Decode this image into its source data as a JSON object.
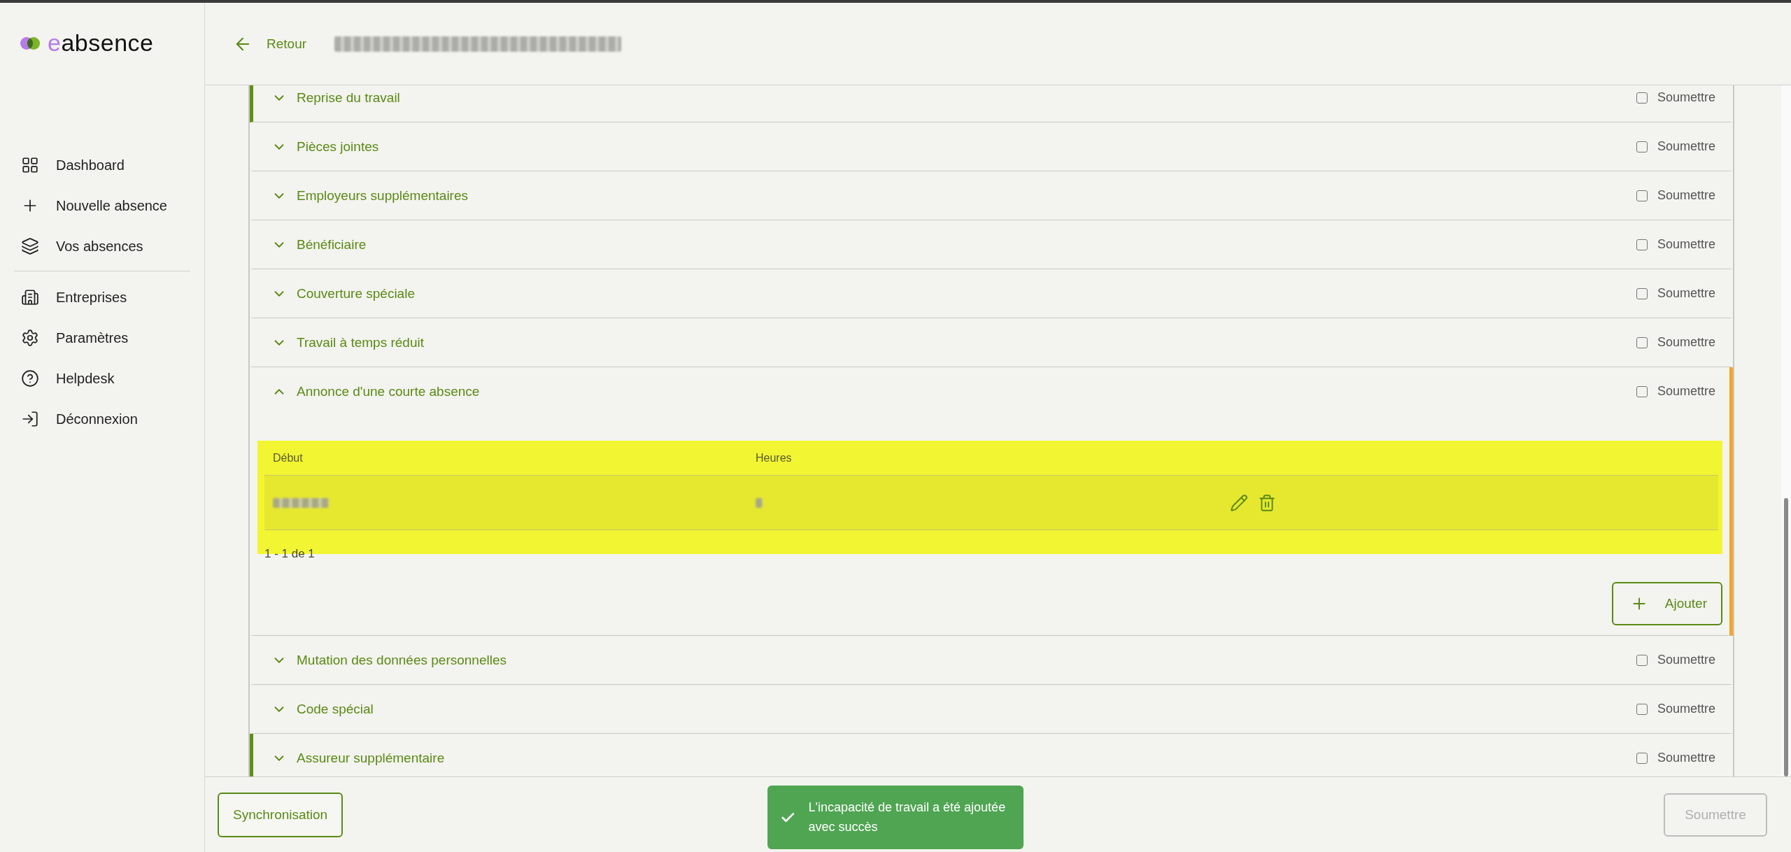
{
  "logo": {
    "accent": "e",
    "text": "absence"
  },
  "nav": [
    {
      "items": [
        {
          "label": "Dashboard"
        },
        {
          "label": "Nouvelle absence"
        },
        {
          "label": "Vos absences"
        }
      ]
    },
    {
      "items": [
        {
          "label": "Entreprises"
        },
        {
          "label": "Paramètres"
        },
        {
          "label": "Helpdesk"
        },
        {
          "label": "Déconnexion"
        }
      ]
    }
  ],
  "header": {
    "back": "Retour"
  },
  "sections": [
    {
      "title": "Reprise du travail",
      "expanded": false,
      "checked": false,
      "checkbox_label": "Soumettre",
      "marked_left": true,
      "color": "#5f8f1a"
    },
    {
      "title": "Pièces jointes",
      "expanded": false,
      "checked": false,
      "checkbox_label": "Soumettre"
    },
    {
      "title": "Employeurs supplémentaires",
      "expanded": false,
      "checked": false,
      "checkbox_label": "Soumettre"
    },
    {
      "title": "Bénéficiaire",
      "expanded": false,
      "checked": false,
      "checkbox_label": "Soumettre"
    },
    {
      "title": "Couverture spéciale",
      "expanded": false,
      "checked": false,
      "checkbox_label": "Soumettre"
    },
    {
      "title": "Travail à temps réduit",
      "expanded": false,
      "checked": false,
      "checkbox_label": "Soumettre"
    },
    {
      "title": "Annonce d'une courte absence",
      "expanded": true,
      "checked": false,
      "checkbox_label": "Soumettre",
      "marked_right": true,
      "color": "#f5a623",
      "table": {
        "columns": [
          "Début",
          "Heures"
        ],
        "rows": [
          {
            "kind": "blurred"
          }
        ],
        "pagination": "1 - 1 de 1",
        "add_button": "Ajouter"
      }
    },
    {
      "title": "Mutation des données personnelles",
      "expanded": false,
      "checked": false,
      "checkbox_label": "Soumettre"
    },
    {
      "title": "Code spécial",
      "expanded": false,
      "checked": false,
      "checkbox_label": "Soumettre"
    },
    {
      "title": "Assureur supplémentaire",
      "expanded": false,
      "checked": false,
      "checkbox_label": "Soumettre",
      "marked_left": true,
      "color": "#5f8f1a"
    }
  ],
  "footer": {
    "sync_button": "Synchronisation",
    "submit_button": {
      "label": "Soumettre",
      "disabled": true
    }
  },
  "toast": "L'incapacité de travail a été ajoutée avec succès"
}
